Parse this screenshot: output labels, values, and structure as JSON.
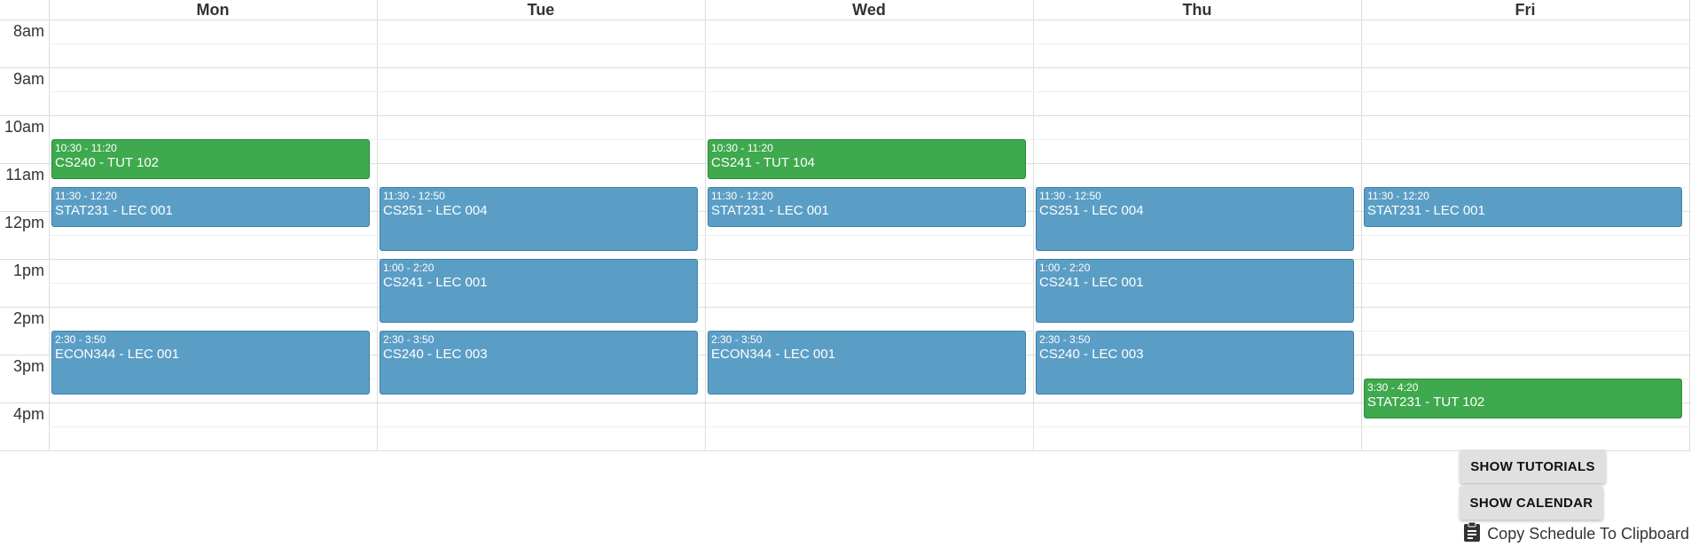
{
  "days": [
    "Mon",
    "Tue",
    "Wed",
    "Thu",
    "Fri"
  ],
  "times": [
    "8am",
    "9am",
    "10am",
    "11am",
    "12pm",
    "1pm",
    "2pm",
    "3pm",
    "4pm"
  ],
  "colors": {
    "lecture": "#5b9ec5",
    "lecture_border": "#3d7fa8",
    "tutorial": "#3ea94d",
    "tutorial_border": "#2a8a38"
  },
  "events": [
    {
      "day": 0,
      "start": "10:30",
      "end": "11:20",
      "time_label": "10:30 - 11:20",
      "name": "CS240 - TUT 102",
      "kind": "tutorial"
    },
    {
      "day": 0,
      "start": "11:30",
      "end": "12:20",
      "time_label": "11:30 - 12:20",
      "name": "STAT231 - LEC 001",
      "kind": "lecture"
    },
    {
      "day": 0,
      "start": "14:30",
      "end": "15:50",
      "time_label": "2:30 - 3:50",
      "name": "ECON344 - LEC 001",
      "kind": "lecture"
    },
    {
      "day": 1,
      "start": "11:30",
      "end": "12:50",
      "time_label": "11:30 - 12:50",
      "name": "CS251 - LEC 004",
      "kind": "lecture"
    },
    {
      "day": 1,
      "start": "13:00",
      "end": "14:20",
      "time_label": "1:00 - 2:20",
      "name": "CS241 - LEC 001",
      "kind": "lecture"
    },
    {
      "day": 1,
      "start": "14:30",
      "end": "15:50",
      "time_label": "2:30 - 3:50",
      "name": "CS240 - LEC 003",
      "kind": "lecture"
    },
    {
      "day": 2,
      "start": "10:30",
      "end": "11:20",
      "time_label": "10:30 - 11:20",
      "name": "CS241 - TUT 104",
      "kind": "tutorial"
    },
    {
      "day": 2,
      "start": "11:30",
      "end": "12:20",
      "time_label": "11:30 - 12:20",
      "name": "STAT231 - LEC 001",
      "kind": "lecture"
    },
    {
      "day": 2,
      "start": "14:30",
      "end": "15:50",
      "time_label": "2:30 - 3:50",
      "name": "ECON344 - LEC 001",
      "kind": "lecture"
    },
    {
      "day": 3,
      "start": "11:30",
      "end": "12:50",
      "time_label": "11:30 - 12:50",
      "name": "CS251 - LEC 004",
      "kind": "lecture"
    },
    {
      "day": 3,
      "start": "13:00",
      "end": "14:20",
      "time_label": "1:00 - 2:20",
      "name": "CS241 - LEC 001",
      "kind": "lecture"
    },
    {
      "day": 3,
      "start": "14:30",
      "end": "15:50",
      "time_label": "2:30 - 3:50",
      "name": "CS240 - LEC 003",
      "kind": "lecture"
    },
    {
      "day": 4,
      "start": "11:30",
      "end": "12:20",
      "time_label": "11:30 - 12:20",
      "name": "STAT231 - LEC 001",
      "kind": "lecture"
    },
    {
      "day": 4,
      "start": "15:30",
      "end": "16:20",
      "time_label": "3:30 - 4:20",
      "name": "STAT231 - TUT 102",
      "kind": "tutorial"
    }
  ],
  "buttons": {
    "show_tutorials": "SHOW TUTORIALS",
    "show_calendar": "SHOW CALENDAR"
  },
  "copy_label": "Copy Schedule To Clipboard",
  "copy_icon": "clipboard-icon"
}
